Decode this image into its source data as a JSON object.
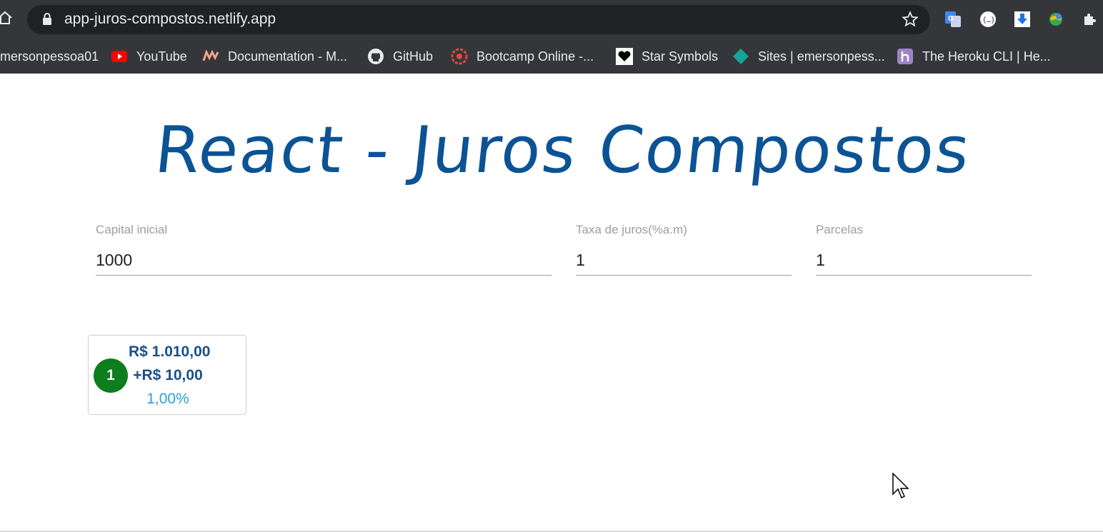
{
  "browser": {
    "url": "app-juros-compostos.netlify.app",
    "bookmarks": [
      {
        "label": "mersonpessoa01",
        "icon": "none"
      },
      {
        "label": "YouTube",
        "icon": "youtube-icon"
      },
      {
        "label": "Documentation - M...",
        "icon": "mui-icon"
      },
      {
        "label": "GitHub",
        "icon": "github-icon"
      },
      {
        "label": "Bootcamp Online -...",
        "icon": "bootcamp-icon"
      },
      {
        "label": "Star Symbols",
        "icon": "heart-icon"
      },
      {
        "label": "Sites | emersonpess...",
        "icon": "diamond-icon"
      },
      {
        "label": "The Heroku CLI | He...",
        "icon": "heroku-icon"
      }
    ],
    "extensions": [
      "translate-icon",
      "json-icon",
      "download-icon",
      "globe-icon",
      "puzzle-icon"
    ]
  },
  "page": {
    "title": "React - Juros Compostos",
    "fields": {
      "capital": {
        "label": "Capital inicial",
        "value": "1000"
      },
      "taxa": {
        "label": "Taxa de juros(%a.m)",
        "value": "1"
      },
      "parcelas": {
        "label": "Parcelas",
        "value": "1"
      }
    },
    "installments": [
      {
        "number": "1",
        "total": "R$ 1.010,00",
        "gain": "+R$ 10,00",
        "percent": "1,00%"
      }
    ]
  },
  "colors": {
    "title": "#0b5394",
    "badge": "#0e7d1d",
    "total": "#1a4f8b",
    "percent": "#2c9fd9"
  }
}
